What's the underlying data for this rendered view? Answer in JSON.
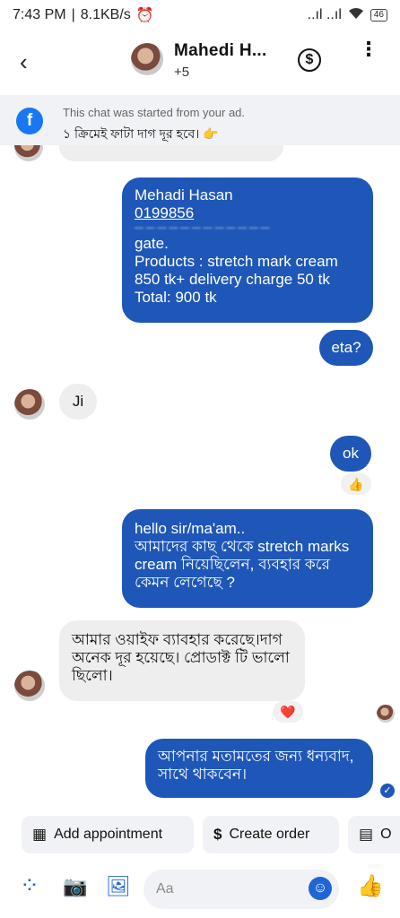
{
  "status_bar": {
    "time": "7:43 PM",
    "speed": "8.1KB/s",
    "alarm": "⏰",
    "signal": "..ıl ..ıl",
    "battery": "46"
  },
  "header": {
    "name": "Mahedi H...",
    "subtitle": "+5",
    "back": "‹",
    "dollar": "$",
    "more": "⋮"
  },
  "ad_banner": {
    "line1": "This chat was started from your ad.",
    "line2": "১ ক্রিমেই ফাটা দাগ দূর হবে। 👉"
  },
  "messages": {
    "order": {
      "name": "Mehadi Hasan",
      "phone": "0199856",
      "blurred": "— — —  — — — —  — —  — — —",
      "l1": "gate.",
      "l2": "Products : stretch mark cream",
      "l3": "850 tk+ delivery charge 50 tk",
      "l4": "Total: 900 tk"
    },
    "eta": "eta?",
    "ji": "Ji",
    "ok": "ok",
    "ok_reaction": "👍",
    "hello": {
      "l1": "hello sir/ma'am..",
      "l2": "আমাদের কাছ থেকে stretch marks",
      "l3": "cream নিয়েছিলেন, ব্যবহার করে",
      "l4": "কেমন লেগেছে ?"
    },
    "reply": {
      "l1": "আমার ওয়াইফ ব্যাবহার করেছে।দাগ",
      "l2": "অনেক দূর হয়েছে। প্রোডাক্ট টি ভালো",
      "l3": "ছিলো।"
    },
    "reply_reaction": "❤️",
    "thanks": {
      "l1": "আপনার মতামতের জন্য ধন্যবাদ,",
      "l2": "সাথে থাকবেন।"
    },
    "seen": "✓"
  },
  "quick_actions": [
    {
      "icon": "▦",
      "label": "Add appointment"
    },
    {
      "icon": "$",
      "label": "Create order"
    },
    {
      "icon": "▤",
      "label": "O"
    }
  ],
  "composer": {
    "placeholder": "Aa",
    "grid": "⁘",
    "camera": "📷",
    "gallery": "🖼",
    "emoji": "☺",
    "like": "👍"
  }
}
